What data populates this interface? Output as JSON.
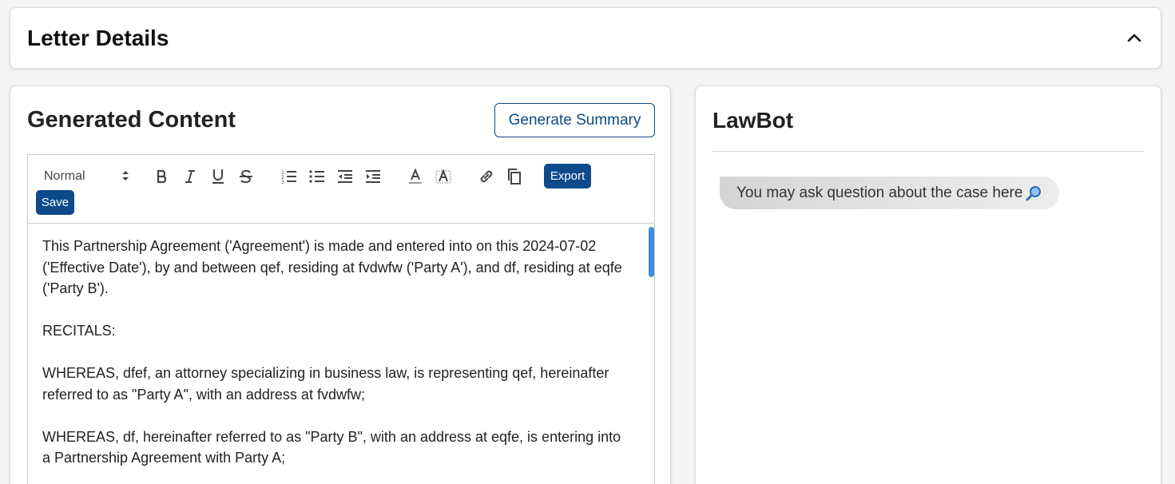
{
  "letter_details": {
    "title": "Letter Details",
    "toggle_icon": "chevron-up-icon"
  },
  "generated_content": {
    "title": "Generated Content",
    "generate_summary_label": "Generate Summary",
    "toolbar": {
      "format_value": "Normal",
      "icons": [
        "bold-icon",
        "italic-icon",
        "underline-icon",
        "strikethrough-icon",
        "ordered-list-icon",
        "bullet-list-icon",
        "outdent-icon",
        "indent-icon",
        "text-color-icon",
        "highlight-color-icon",
        "link-icon",
        "copy-icon"
      ],
      "export_label": "Export",
      "save_label": "Save"
    },
    "paragraphs": [
      "This Partnership Agreement ('Agreement') is made and entered into on this 2024-07-02 ('Effective Date'), by and between qef, residing at fvdwfw ('Party A'), and df, residing at eqfe ('Party B').",
      "RECITALS:",
      "WHEREAS, dfef, an attorney specializing in business law, is representing qef, hereinafter referred to as \"Party A\", with an address at fvdwfw;",
      "WHEREAS, df, hereinafter referred to as \"Party B\", with an address at eqfe, is entering into a Partnership Agreement with Party A;"
    ]
  },
  "lawbot": {
    "title": "LawBot",
    "greeting": "You may ask question about the case here",
    "greeting_icon": "magnifier-icon"
  },
  "colors": {
    "primary": "#0d4a8a",
    "scrollbar": "#3d8fe0",
    "background": "#f5f5f5"
  }
}
